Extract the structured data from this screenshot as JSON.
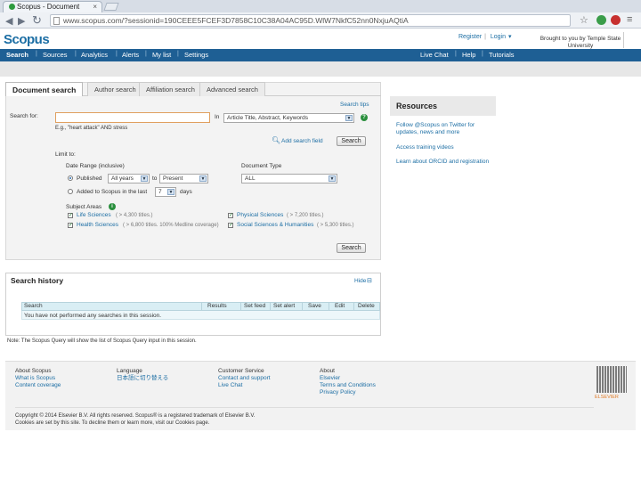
{
  "browser": {
    "tab_title": "Scopus - Document",
    "tab_close": "×",
    "url": "www.scopus.com/?sessionid=190CEEE5FCEF3D7858C10C38A04AC95D.WlW7NkfC52nn0NxjuAQtiA",
    "back_glyph": "◀",
    "forward_glyph": "▶",
    "reload_glyph": "↻",
    "star_glyph": "☆"
  },
  "header": {
    "logo": "Scopus",
    "register": "Register",
    "login": "Login",
    "login_caret": "▾",
    "institution": "Brought to you by Temple State University"
  },
  "nav": {
    "left": [
      "Search",
      "Sources",
      "Analytics",
      "Alerts",
      "My list",
      "Settings"
    ],
    "right": [
      "Live Chat",
      "Help",
      "Tutorials"
    ]
  },
  "search": {
    "tabs": [
      "Document search",
      "Author search",
      "Affiliation search",
      "Advanced search"
    ],
    "search_tips": "Search tips",
    "search_for_label": "Search for:",
    "search_value": "",
    "example": "E.g., \"heart attack\" AND stress",
    "in_label": "In",
    "field_select": "Article Title, Abstract, Keywords",
    "help_glyph": "?",
    "add_field": "Add search field",
    "search_button": "Search",
    "limit_to": "Limit to:",
    "date_range_label": "Date Range (inclusive)",
    "published_label": "Published",
    "published_from": "All years",
    "to_label": "to",
    "published_to": "Present",
    "added_label": "Added to Scopus in the last",
    "added_days": "7",
    "days_label": "days",
    "doctype_label": "Document Type",
    "doctype_value": "ALL",
    "subject_label": "Subject Areas",
    "subjects": [
      {
        "name": "Life Sciences",
        "count": "( > 4,300 titles.)",
        "checked": true
      },
      {
        "name": "Physical Sciences",
        "count": "( > 7,200 titles.)",
        "checked": true
      },
      {
        "name": "Health Sciences",
        "count": "( > 6,800 titles. 100% Medline coverage)",
        "checked": true
      },
      {
        "name": "Social Sciences & Humanities",
        "count": "( > 5,300 titles.)",
        "checked": true
      }
    ],
    "search_button_bottom": "Search"
  },
  "history": {
    "title": "Search history",
    "hide": "Hide",
    "columns": [
      "Search",
      "Results",
      "Set feed",
      "Set alert",
      "Save",
      "Edit",
      "Delete"
    ],
    "empty_message": "You have not performed any searches in this session.",
    "note": "Note: The Scopus Query will show the list of Scopus Query input in this session."
  },
  "resources": {
    "title": "Resources",
    "items": [
      "Follow @Scopus on Twitter for updates, news and more",
      "Access training videos",
      "Learn about ORCID and registration"
    ]
  },
  "footer": {
    "columns": [
      {
        "head": "About Scopus",
        "links": [
          "What is Scopus",
          "Content coverage"
        ]
      },
      {
        "head": "Language",
        "links": [
          "日本語に切り替える"
        ]
      },
      {
        "head": "Customer Service",
        "links": [
          "Contact and support",
          "Live Chat"
        ]
      },
      {
        "head": "About",
        "links": [
          "Elsevier",
          "Terms and Conditions",
          "Privacy Policy"
        ]
      }
    ],
    "copyright": "Copyright © 2014 Elsevier B.V. All rights reserved. Scopus® is a registered trademark of Elsevier B.V.",
    "cookies": "Cookies are set by this site. To decline them or learn more, visit our Cookies page.",
    "elsevier": "ELSEVIER"
  },
  "colors": {
    "brand_blue": "#1c6ea4",
    "nav_bar": "#1e5f94",
    "elsevier_orange": "#e07b28"
  }
}
